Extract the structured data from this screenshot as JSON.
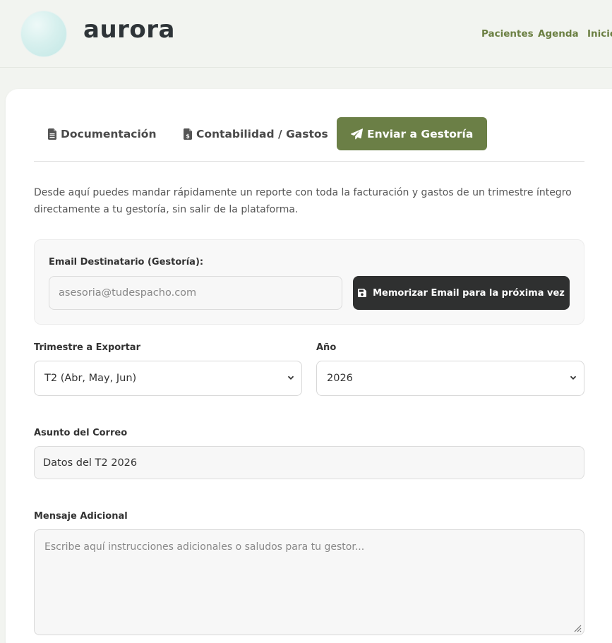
{
  "brand": {
    "name": "aurora"
  },
  "nav": {
    "items": [
      "Pacientes",
      "Agenda",
      "Inicio"
    ]
  },
  "tabs": [
    {
      "label": "Documentación",
      "icon": "file-text-icon"
    },
    {
      "label": "Contabilidad / Gastos",
      "icon": "file-invoice-dollar-icon"
    },
    {
      "label": "Enviar a Gestoría",
      "icon": "paper-plane-icon",
      "active": true
    }
  ],
  "intro_text": "Desde aquí puedes mandar rápidamente un reporte con toda la facturación y gastos de un trimestre íntegro directamente a tu gestoría, sin salir de la plataforma.",
  "email_section": {
    "label": "Email Destinatario (Gestoría):",
    "placeholder": "asesoria@tudespacho.com",
    "value": "",
    "save_button": "Memorizar Email para la próxima vez",
    "save_icon": "floppy-disk-icon"
  },
  "quarter": {
    "label": "Trimestre a Exportar",
    "selected": "T2 (Abr, May, Jun)"
  },
  "year": {
    "label": "Año",
    "selected": "2026"
  },
  "subject": {
    "label": "Asunto del Correo",
    "value": "Datos del T2 2026"
  },
  "message": {
    "label": "Mensaje Adicional",
    "placeholder": "Escribe aquí instrucciones adicionales o saludos para tu gestor..."
  },
  "colors": {
    "accent": "#6b7f46",
    "nav_link": "#6b7f42",
    "dark_button": "#2f3030"
  }
}
